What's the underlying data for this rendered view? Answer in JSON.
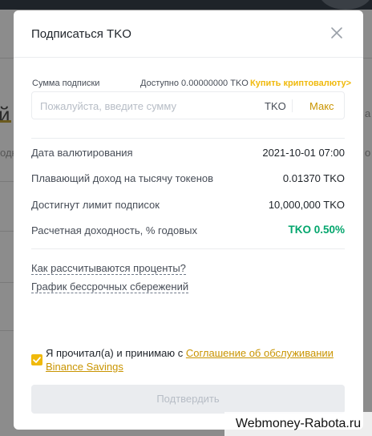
{
  "background": {
    "partial_heading": "й",
    "partial_left_text": "одн",
    "partial_right_text_1": "а",
    "partial_right_text_2": "о"
  },
  "modal": {
    "title": "Подписаться TKO",
    "subscription_amount_label": "Сумма подписки",
    "available_label": "Доступно 0.00000000 TKO",
    "buy_crypto_link": "Купить криптовалюту>",
    "amount_placeholder": "Пожалуйста, введите сумму",
    "amount_value": "",
    "amount_unit": "TKO",
    "max_label": "Макс",
    "rows": [
      {
        "label": "Дата валютирования",
        "value": "2021-10-01 07:00"
      },
      {
        "label": "Плавающий доход на тысячу токенов",
        "value": "0.01370 TKO"
      },
      {
        "label": "Достигнут лимит подписок",
        "value": "10,000,000 TKO"
      },
      {
        "label": "Расчетная доходность, % годовых",
        "value": "TKO 0.50%"
      }
    ],
    "links": [
      "Как рассчитываются проценты?",
      "График бессрочных сбережений"
    ],
    "agreement_text": "Я прочитал(а) и принимаю с ",
    "agreement_link": "Соглашение об обслуживании Binance Savings",
    "agreement_checked": true,
    "confirm_label": "Подтвердить"
  },
  "colors": {
    "accent": "#f0b90b",
    "positive": "#03a66d",
    "disabled_button": "#eaecef"
  },
  "watermark": "Webmoney-Rabota.ru"
}
